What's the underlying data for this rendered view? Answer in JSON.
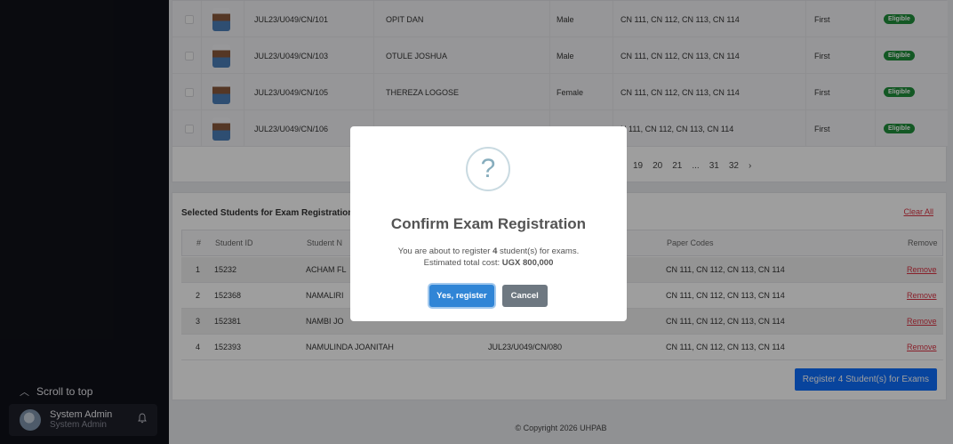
{
  "sidebar": {
    "scroll_to_top": "Scroll to top",
    "user": {
      "name": "System Admin",
      "role": "System Admin"
    }
  },
  "students_table": {
    "rows": [
      {
        "reg_no": "JUL23/U049/CN/101",
        "name": "OPIT DAN",
        "gender": "Male",
        "codes": "CN 111, CN 112, CN 113, CN 114",
        "sitting": "First",
        "status": "Eligible"
      },
      {
        "reg_no": "JUL23/U049/CN/103",
        "name": "OTULE JOSHUA",
        "gender": "Male",
        "codes": "CN 111, CN 112, CN 113, CN 114",
        "sitting": "First",
        "status": "Eligible"
      },
      {
        "reg_no": "JUL23/U049/CN/105",
        "name": "THEREZA LOGOSE",
        "gender": "Female",
        "codes": "CN 111, CN 112, CN 113, CN 114",
        "sitting": "First",
        "status": "Eligible"
      },
      {
        "reg_no": "JUL23/U049/CN/106",
        "name": "",
        "gender": "",
        "codes": "N 111, CN 112, CN 113, CN 114",
        "sitting": "First",
        "status": "Eligible"
      }
    ],
    "pagination": [
      "19",
      "20",
      "21",
      "...",
      "31",
      "32",
      "›"
    ]
  },
  "selected": {
    "title": "Selected Students for Exam Registration",
    "count": "4",
    "clear_all": "Clear All",
    "headers": {
      "num": "#",
      "student_id": "Student ID",
      "student_name": "Student N",
      "reg_no": "",
      "paper_codes": "Paper Codes",
      "remove": "Remove"
    },
    "rows": [
      {
        "num": "1",
        "student_id": "15232",
        "name": "ACHAM FL",
        "reg_no": "",
        "codes": "CN 111, CN 112, CN 113, CN 114",
        "remove": "Remove"
      },
      {
        "num": "2",
        "student_id": "152368",
        "name": "NAMALIRI",
        "reg_no": "",
        "codes": "CN 111, CN 112, CN 113, CN 114",
        "remove": "Remove"
      },
      {
        "num": "3",
        "student_id": "152381",
        "name": "NAMBI JO",
        "reg_no": "",
        "codes": "CN 111, CN 112, CN 113, CN 114",
        "remove": "Remove"
      },
      {
        "num": "4",
        "student_id": "152393",
        "name": "NAMULINDA JOANITAH",
        "reg_no": "JUL23/U049/CN/080",
        "codes": "CN 111, CN 112, CN 113, CN 114",
        "remove": "Remove"
      }
    ],
    "register_button": "Register 4 Student(s) for Exams"
  },
  "footer": "© Copyright 2026 UHPAB",
  "modal": {
    "icon": "?",
    "title": "Confirm Exam Registration",
    "line1_prefix": "You are about to register ",
    "line1_count": "4",
    "line1_suffix": " student(s) for exams.",
    "line2_prefix": "Estimated total cost: ",
    "line2_amount": "UGX 800,000",
    "confirm": "Yes, register",
    "cancel": "Cancel"
  }
}
